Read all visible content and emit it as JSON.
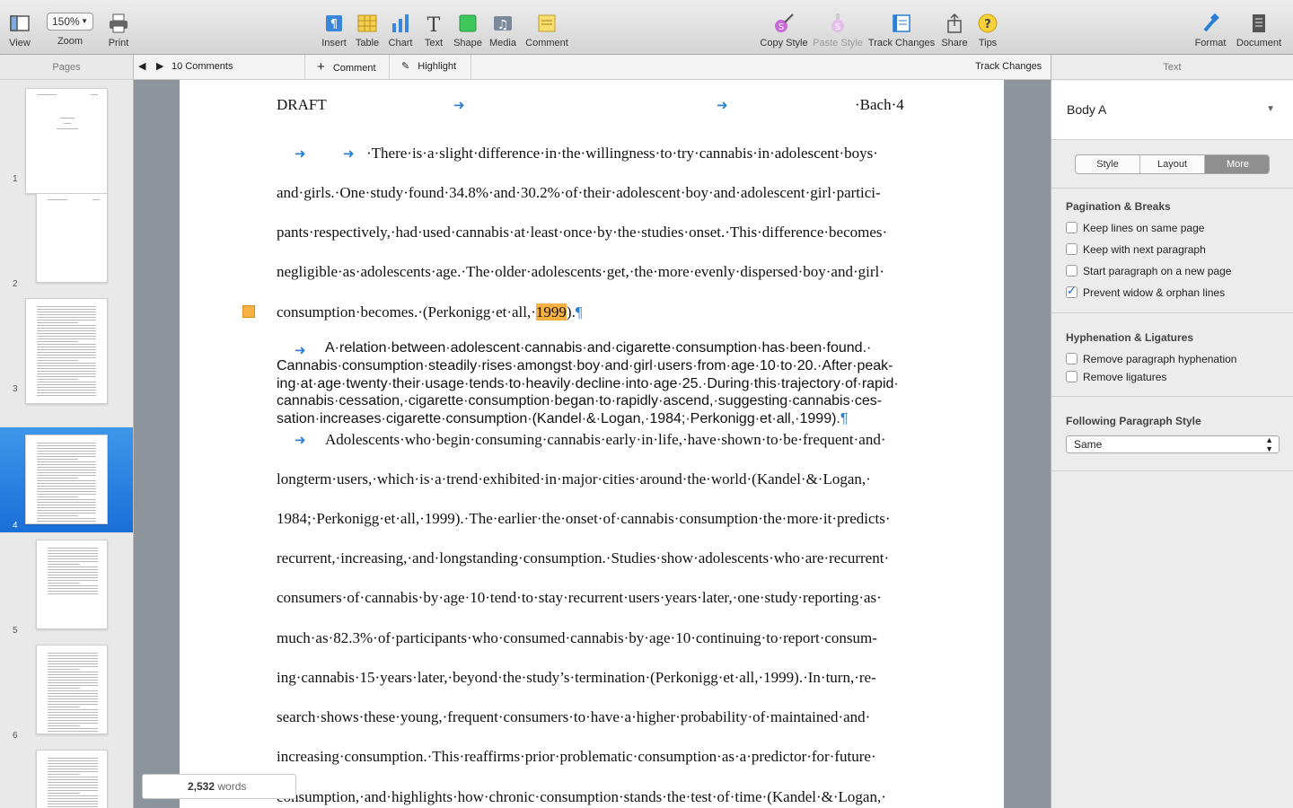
{
  "toolbar": {
    "view": "View",
    "zoom_value": "150%",
    "zoom": "Zoom",
    "print": "Print",
    "insert": "Insert",
    "table": "Table",
    "chart": "Chart",
    "text": "Text",
    "shape": "Shape",
    "media": "Media",
    "comment": "Comment",
    "copy_style": "Copy Style",
    "paste_style": "Paste Style",
    "track_changes": "Track Changes",
    "share": "Share",
    "tips": "Tips",
    "format": "Format",
    "document": "Document"
  },
  "sidebar": {
    "title": "Pages",
    "pages": [
      "1",
      "2",
      "3",
      "4",
      "5",
      "6"
    ],
    "selected": "4"
  },
  "comments_bar": {
    "count": "10 Comments",
    "comment": "Comment",
    "highlight": "Highlight",
    "track_changes": "Track Changes"
  },
  "document": {
    "header_left": "DRAFT",
    "header_right": "·Bach·4",
    "p1": [
      "·There·is·a·slight·difference·in·the·willingness·to·try·cannabis·in·adolescent·boys·",
      "and·girls.·One·study·found·34.8%·and·30.2%·of·their·adolescent·boy·and·adolescent·girl·partici-",
      "pants·respectively,·had·used·cannabis·at·least·once·by·the·studies·onset.·This·difference·becomes·",
      "negligible·as·adolescents·age.·The·older·adolescents·get,·the·more·evenly·dispersed·boy·and·girl·"
    ],
    "p1_last_a": "consumption·becomes.·(Perkonigg·et·all,·",
    "p1_last_hl": "1999",
    "p1_last_b": ").",
    "pilcrow": "¶",
    "p2": [
      "A·relation·between·adolescent·cannabis·and·cigarette·consumption·has·been·found.·",
      "Cannabis·consumption·steadily·rises·amongst·boy·and·girl·users·from·age·10·to·20.·After·peak-",
      "ing·at·age·twenty·their·usage·tends·to·heavily·decline·into·age·25.·During·this·trajectory·of·rapid·",
      "cannabis·cessation,·cigarette·consumption·began·to·rapidly·ascend,·suggesting·cannabis·ces-",
      "sation·increases·cigarette·consumption·(Kandel·&·Logan,·1984;·Perkonigg·et·all,·1999)."
    ],
    "p3": [
      "Adolescents·who·begin·consuming·cannabis·early·in·life,·have·shown·to·be·frequent·and·",
      "longterm·users,·which·is·a·trend·exhibited·in·major·cities·around·the·world·(Kandel·&·Logan,·",
      "1984;·Perkonigg·et·all,·1999).·The·earlier·the·onset·of·cannabis·consumption·the·more·it·predicts·",
      "recurrent,·increasing,·and·longstanding·consumption.·Studies·show·adolescents·who·are·recurrent·",
      "consumers·of·cannabis·by·age·10·tend·to·stay·recurrent·users·years·later,·one·study·reporting·as·",
      "much·as·82.3%·of·participants·who·consumed·cannabis·by·age·10·continuing·to·report·consum-",
      "ing·cannabis·15·years·later,·beyond·the·study’s·termination·(Perkonigg·et·all,·1999).·In·turn,·re-",
      "search·shows·these·young,·frequent·consumers·to·have·a·higher·probability·of·maintained·and·",
      "increasing·consumption.·This·reaffirms·prior·problematic·consumption·as·a·predictor·for·future·",
      "consumption,·and·highlights·how·chronic·consumption·stands·the·test·of·time·(Kandel·&·Logan,·"
    ]
  },
  "word_count": {
    "number": "2,532",
    "label": "words"
  },
  "inspector": {
    "title": "Text",
    "style_name": "Body A",
    "tabs": [
      "Style",
      "Layout",
      "More"
    ],
    "active_tab": "More",
    "pagination_title": "Pagination & Breaks",
    "pagination": [
      {
        "label": "Keep lines on same page",
        "checked": false
      },
      {
        "label": "Keep with next paragraph",
        "checked": false
      },
      {
        "label": "Start paragraph on a new page",
        "checked": false
      },
      {
        "label": "Prevent widow & orphan lines",
        "checked": true
      }
    ],
    "hyphen_title": "Hyphenation & Ligatures",
    "hyphen": [
      {
        "label": "Remove paragraph hyphenation",
        "checked": false
      },
      {
        "label": "Remove ligatures",
        "checked": false
      }
    ],
    "following_title": "Following Paragraph Style",
    "following_value": "Same"
  },
  "colors": {
    "accent": "#2a7fd4",
    "highlight": "#f7b042",
    "selection": "#1a6fd8"
  }
}
